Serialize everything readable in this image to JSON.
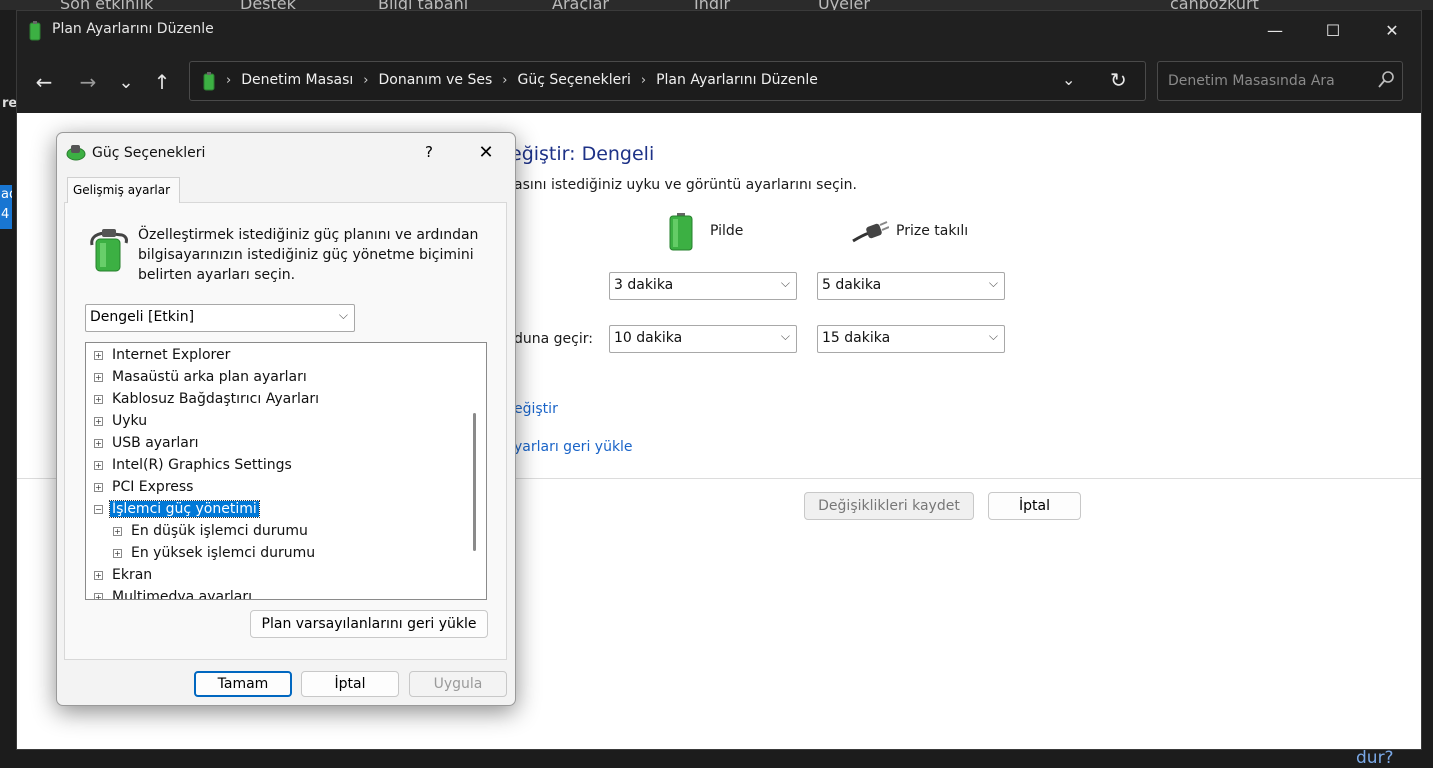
{
  "background": {
    "tabs": [
      "Son etkinlik",
      "Destek",
      "Bilgi tabanı",
      "Araçlar",
      "İndir",
      "Üyeler",
      "canbozkurt"
    ],
    "left_text": "re",
    "left_selected": "ad 4",
    "right_bottom": "dur?"
  },
  "window": {
    "title": "Plan Ayarlarını Düzenle",
    "minimize": "—",
    "maximize": "☐",
    "close": "✕"
  },
  "nav": {
    "back": "←",
    "forward": "→",
    "recent": "⌄",
    "up": "↑"
  },
  "address": {
    "breadcrumb": [
      "Denetim Masası",
      "Donanım ve Ses",
      "Güç Seçenekleri",
      "Plan Ayarlarını Düzenle"
    ],
    "separator": "›",
    "dropdown": "⌄",
    "refresh": "↻"
  },
  "search": {
    "placeholder": "Denetim Masasında Ara"
  },
  "content": {
    "title": "eğiştir: Dengeli",
    "description": "asını istediğiniz uyku ve görüntü ayarlarını seçin.",
    "column_battery": "Pilde",
    "column_plugged": "Prize takılı",
    "row2_label": "duna geçir:",
    "display_battery": "3 dakika",
    "display_plugged": "5 dakika",
    "sleep_battery": "10 dakika",
    "sleep_plugged": "15 dakika",
    "link_advanced": "eğiştir",
    "link_restore": "yarları geri yükle",
    "save_button": "Değişiklikleri kaydet",
    "cancel_button": "İptal"
  },
  "dialog": {
    "title": "Güç Seçenekleri",
    "help": "?",
    "close": "✕",
    "tab": "Gelişmiş ayarlar",
    "description": "Özelleştirmek istediğiniz güç planını ve ardından bilgisayarınızın istediğiniz güç yönetme biçimini belirten ayarları seçin.",
    "plan_selected": "Dengeli [Etkin]",
    "tree": [
      {
        "label": "Internet Explorer",
        "expand": "+"
      },
      {
        "label": "Masaüstü arka plan ayarları",
        "expand": "+"
      },
      {
        "label": "Kablosuz Bağdaştırıcı Ayarları",
        "expand": "+"
      },
      {
        "label": "Uyku",
        "expand": "+"
      },
      {
        "label": "USB ayarları",
        "expand": "+"
      },
      {
        "label": "Intel(R) Graphics Settings",
        "expand": "+"
      },
      {
        "label": "PCI Express",
        "expand": "+"
      },
      {
        "label": "İşlemci güç yönetimi",
        "expand": "−"
      },
      {
        "label": "En düşük işlemci durumu",
        "expand": "+"
      },
      {
        "label": "En yüksek işlemci durumu",
        "expand": "+"
      },
      {
        "label": "Ekran",
        "expand": "+"
      },
      {
        "label": "Multimedya ayarları",
        "expand": "+"
      }
    ],
    "restore_button": "Plan varsayılanlarını geri yükle",
    "ok_button": "Tamam",
    "cancel_button": "İptal",
    "apply_button": "Uygula"
  },
  "colors": {
    "title_blue": "#1e3287",
    "link_blue": "#1a64c8",
    "selection": "#0078d7",
    "dark_chrome": "#202020"
  }
}
